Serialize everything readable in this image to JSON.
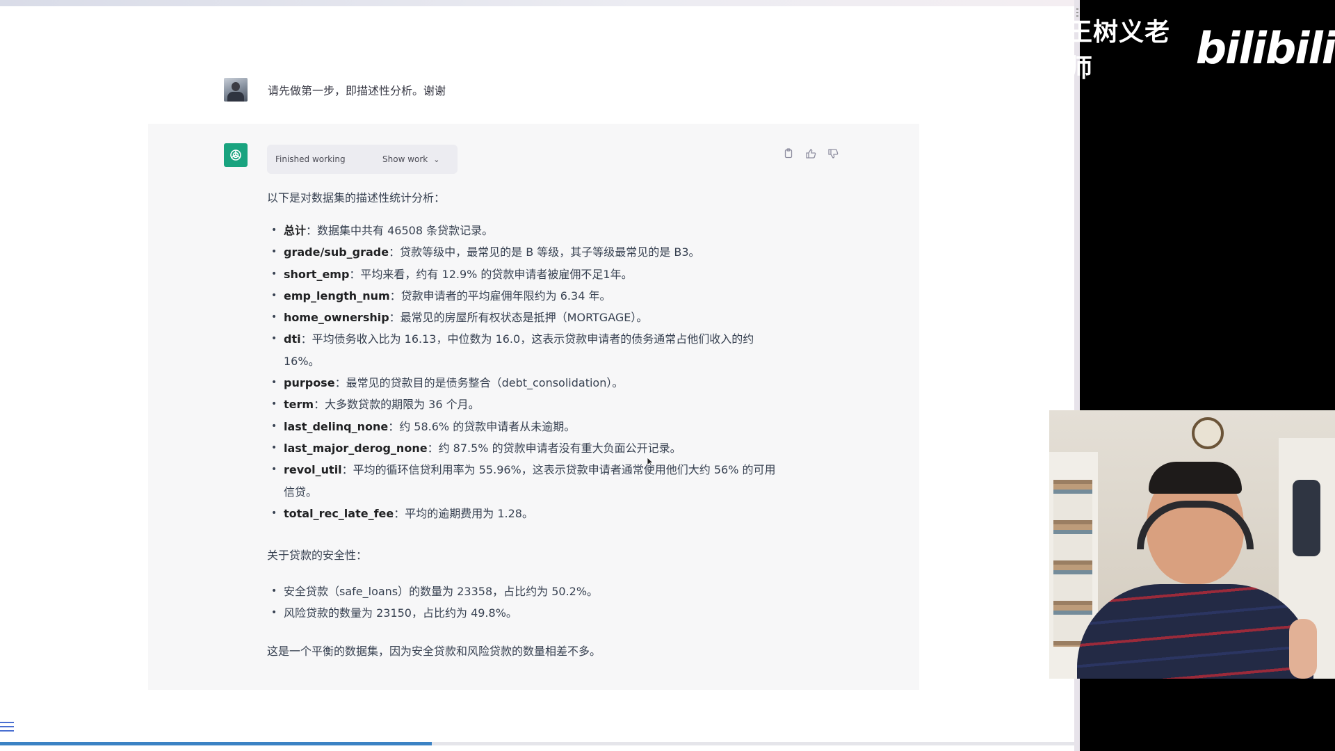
{
  "overlay": {
    "presenter_name": "王树义老师",
    "platform_logo": "bilibili"
  },
  "conversation": {
    "user_message": "请先做第一步，即描述性分析。谢谢",
    "assistant": {
      "status_label": "Finished working",
      "show_work_label": "Show work",
      "intro": "以下是对数据集的描述性统计分析：",
      "stats": [
        {
          "key": "总计",
          "text": "：数据集中共有 46508 条贷款记录。"
        },
        {
          "key": "grade/sub_grade",
          "text": "：贷款等级中，最常见的是 B 等级，其子等级最常见的是 B3。"
        },
        {
          "key": "short_emp",
          "text": "：平均来看，约有 12.9% 的贷款申请者被雇佣不足1年。"
        },
        {
          "key": "emp_length_num",
          "text": "：贷款申请者的平均雇佣年限约为 6.34 年。"
        },
        {
          "key": "home_ownership",
          "text": "：最常见的房屋所有权状态是抵押（MORTGAGE）。"
        },
        {
          "key": "dti",
          "text": "：平均债务收入比为 16.13，中位数为 16.0，这表示贷款申请者的债务通常占他们收入的约 16%。"
        },
        {
          "key": "purpose",
          "text": "：最常见的贷款目的是债务整合（debt_consolidation）。"
        },
        {
          "key": "term",
          "text": "：大多数贷款的期限为 36 个月。"
        },
        {
          "key": "last_delinq_none",
          "text": "：约 58.6% 的贷款申请者从未逾期。"
        },
        {
          "key": "last_major_derog_none",
          "text": "：约 87.5% 的贷款申请者没有重大负面公开记录。"
        },
        {
          "key": "revol_util",
          "text": "：平均的循环信贷利用率为 55.96%，这表示贷款申请者通常使用他们大约 56% 的可用信贷。"
        },
        {
          "key": "total_rec_late_fee",
          "text": "：平均的逾期费用为 1.28。"
        }
      ],
      "safety_heading": "关于贷款的安全性：",
      "safety": [
        "安全贷款（safe_loans）的数量为 23358，占比约为 50.2%。",
        "风险贷款的数量为 23150，占比约为 49.8%。"
      ],
      "conclusion": "这是一个平衡的数据集，因为安全贷款和风险贷款的数量相差不多。"
    }
  },
  "icons": {
    "copy": "copy-icon",
    "thumbs_up": "thumbs-up-icon",
    "thumbs_down": "thumbs-down-icon",
    "menu": "hamburger-menu-icon"
  },
  "video_progress": 0.4,
  "colors": {
    "gpt_green": "#19a37f",
    "panel_bg": "#f7f7f8",
    "progress": "#3b82c4"
  }
}
